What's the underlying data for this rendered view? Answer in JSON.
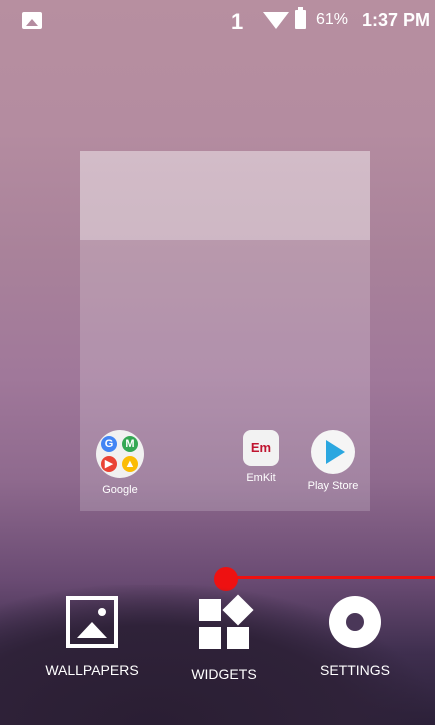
{
  "status_bar": {
    "notification_icon": "image-icon",
    "sim_number": "1",
    "wifi_icon": "wifi-icon",
    "battery_icon": "battery-charging-icon",
    "battery_percent": "61%",
    "time": "1:37 PM"
  },
  "preview": {
    "apps": [
      {
        "label": "Google",
        "icon": "google-folder-icon"
      },
      {
        "label": "EmKit",
        "icon": "emkit-icon"
      },
      {
        "label": "Play Store",
        "icon": "play-store-icon"
      }
    ]
  },
  "bottom_actions": {
    "wallpapers_label": "WALLPAPERS",
    "widgets_label": "WIDGETS",
    "settings_label": "SETTINGS"
  },
  "colors": {
    "indicator": "#ee1111"
  }
}
